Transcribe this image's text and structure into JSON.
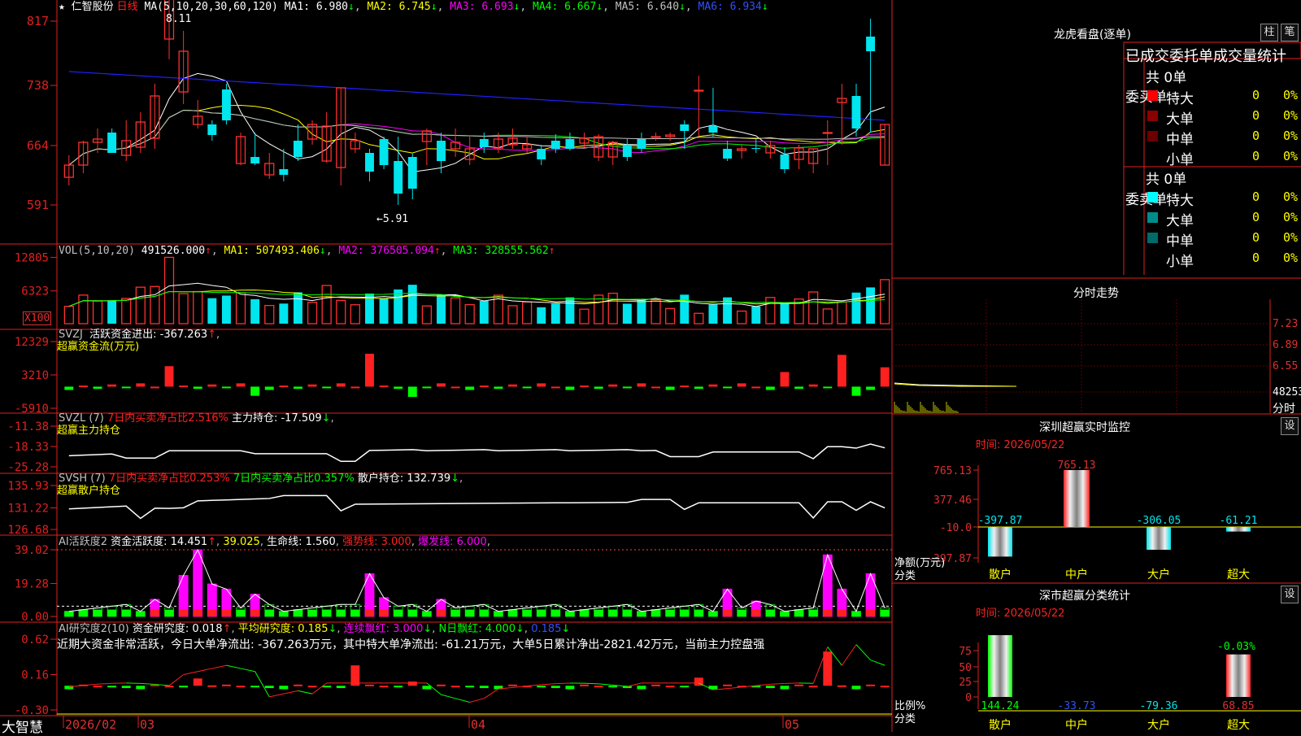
{
  "stock": {
    "name": "仁智股份",
    "period": "日线",
    "brand": "大智慧"
  },
  "colors": {
    "up": "#ff2020",
    "down": "#00e5ee",
    "ma1": "#ffffff",
    "ma2": "#ffff00",
    "ma3": "#ff00ff",
    "ma4": "#00ff00",
    "ma5": "#c0c0c0",
    "ma6": "#2020ff"
  },
  "kline": {
    "legend": {
      "ma": "MA(5,10,20,30,60,120)",
      "ma1": "MA1: 6.980",
      "ma2": "MA2: 6.745",
      "ma3": "MA3: 6.693",
      "ma4": "MA4: 6.667",
      "ma5": "MA5: 6.640",
      "ma6": "MA6: 6.934"
    },
    "yticks": [
      "817",
      "738",
      "664",
      "591"
    ],
    "high_label": "8.11",
    "low_label": "←5.91"
  },
  "vol": {
    "legend": {
      "name": "VOL(5,10,20)",
      "v": "491526.000",
      "ma1": "MA1: 507493.406",
      "ma2": "MA2: 376505.094",
      "ma3": "MA3: 328555.562"
    },
    "yticks": [
      "12805",
      "6323"
    ],
    "unit": "X100"
  },
  "svzj": {
    "legend": {
      "name": "SVZJ",
      "t1": "活跃资金进出: -367.263",
      "t2": "超赢资金流(万元)"
    },
    "yticks": [
      "12329",
      "3210",
      "-5910"
    ]
  },
  "svzl": {
    "legend": {
      "name": "SVZL (7)",
      "t1": "7日内买卖净占比2.516%",
      "t2": "主力持仓: -17.509",
      "t3": "超赢主力持仓"
    },
    "yticks": [
      "-11.38",
      "-18.33",
      "-25.28"
    ]
  },
  "svsh": {
    "legend": {
      "name": "SVSH (7)",
      "t1": "7日内买卖净占比0.253%",
      "t2": "7日内买卖净占比0.357%",
      "t3": "散户持仓: 132.739",
      "t4": "超赢散户持仓"
    },
    "yticks": [
      "135.93",
      "131.22",
      "126.68"
    ]
  },
  "ai1": {
    "legend": {
      "name": "AI活跃度2",
      "t1": "资金活跃度: 14.451",
      "t2": "39.025",
      "t3": "生命线: 1.560",
      "t4": "强势线: 3.000",
      "t5": "爆发线: 6.000"
    },
    "yticks": [
      "39.02",
      "19.28",
      "0.00"
    ]
  },
  "ai2": {
    "legend": {
      "name": "AI研究度2(10)",
      "t1": "资金研究度: 0.018",
      "t2": "平均研究度: 0.185",
      "t3": "连续飘红: 3.000",
      "t4": "N日飘红: 4.000",
      "t5": "0.185"
    },
    "comment": "近期大资金非常活跃，今日大单净流出: -367.263万元，其中特大单净流出: -61.21万元，大单5日累计净出-2821.42万元，当前主力控盘强",
    "yticks": [
      "0.62",
      "0.16",
      "-0.30"
    ]
  },
  "xaxis": {
    "labels": [
      "2026/02",
      "03",
      "04",
      "05"
    ]
  },
  "right": {
    "lhb_title": "龙虎看盘(逐单)",
    "btn1": "柱",
    "btn2": "笔",
    "table_title": "已成交委托单成交量统计",
    "buy": {
      "side": "委买单",
      "total": "共 0单",
      "rows": [
        {
          "name": "特大",
          "v": "0",
          "p": "0%",
          "c": "#ff0000"
        },
        {
          "name": "大单",
          "v": "0",
          "p": "0%",
          "c": "#8b0000"
        },
        {
          "name": "中单",
          "v": "0",
          "p": "0%",
          "c": "#6a0000"
        },
        {
          "name": "小单",
          "v": "0",
          "p": "0%",
          "c": "#000000"
        }
      ]
    },
    "sell": {
      "side": "委卖单",
      "total": "共 0单",
      "rows": [
        {
          "name": "特大",
          "v": "0",
          "p": "0%",
          "c": "#00ffff"
        },
        {
          "name": "大单",
          "v": "0",
          "p": "0%",
          "c": "#008b8b"
        },
        {
          "name": "中单",
          "v": "0",
          "p": "0%",
          "c": "#006a6a"
        },
        {
          "name": "小单",
          "v": "0",
          "p": "0%",
          "c": "#000000"
        }
      ]
    },
    "fs": {
      "title": "分时走势",
      "yticks": [
        "7.23",
        "6.89",
        "6.55",
        "48253"
      ],
      "unit": "分时"
    },
    "sz": {
      "title": "深圳超赢实时监控",
      "btn": "设",
      "time": "时间: 2026/05/22",
      "yticks": [
        "765.13",
        "377.46",
        "-10.0",
        "-397.87"
      ],
      "ylabel1": "净额(万元)",
      "ylabel2": "分类",
      "cats": [
        "散户",
        "中户",
        "大户",
        "超大"
      ],
      "values": [
        -397.87,
        765.13,
        -306.05,
        -61.21
      ],
      "vlabels": [
        "-397.87",
        "765.13",
        "-306.05",
        "-61.21"
      ]
    },
    "sc": {
      "title": "深市超赢分类统计",
      "btn": "设",
      "time": "时间: 2026/05/22",
      "yticks": [
        "75",
        "50",
        "25",
        "0"
      ],
      "ylabel1": "比例%",
      "ylabel2": "分类",
      "cats": [
        "散户",
        "中户",
        "大户",
        "超大"
      ],
      "values": [
        144.24,
        -33.73,
        -79.36,
        68.85
      ],
      "vlabels": [
        "144.24",
        "-33.73",
        "-79.36",
        "68.85"
      ],
      "extra": "-0.03%"
    }
  },
  "chart_data": {
    "type": "candlestick",
    "title": "仁智股份 日线",
    "x": [
      "2026/02",
      "",
      "",
      "",
      "",
      "",
      "",
      "",
      "",
      "",
      "",
      "",
      "",
      "",
      "",
      "",
      "",
      "",
      "",
      "",
      "",
      "",
      "",
      "",
      "",
      "",
      "",
      "",
      "",
      "",
      "",
      "",
      "",
      "",
      "",
      "",
      "",
      "",
      "",
      "",
      "",
      "",
      "",
      "",
      "",
      "",
      "",
      "",
      "",
      "",
      "",
      "",
      "",
      "",
      "",
      "",
      ""
    ],
    "open": [
      6.25,
      6.4,
      6.68,
      6.8,
      6.52,
      6.62,
      6.73,
      7.95,
      7.3,
      6.9,
      6.9,
      7.33,
      6.42,
      6.5,
      6.28,
      6.35,
      6.7,
      6.72,
      6.45,
      6.37,
      6.6,
      6.55,
      6.72,
      6.45,
      6.5,
      6.69,
      6.7,
      6.6,
      6.47,
      6.72,
      6.61,
      6.65,
      6.6,
      6.6,
      6.7,
      6.72,
      6.67,
      6.5,
      6.5,
      6.65,
      6.72,
      6.74,
      6.75,
      6.9,
      7.32,
      6.88,
      6.6,
      6.58,
      6.61,
      6.55,
      6.53,
      6.47,
      6.42,
      6.79,
      7.17,
      7.25,
      7.98,
      6.4
    ],
    "close": [
      6.4,
      6.68,
      6.72,
      6.55,
      6.7,
      6.93,
      7.25,
      8.65,
      7.8,
      7.0,
      6.77,
      6.95,
      6.75,
      6.42,
      6.42,
      6.28,
      6.5,
      6.9,
      6.88,
      7.35,
      6.7,
      6.32,
      6.4,
      6.05,
      6.11,
      6.82,
      6.45,
      6.68,
      6.6,
      6.62,
      6.72,
      6.73,
      6.65,
      6.47,
      6.6,
      6.6,
      6.73,
      6.75,
      6.68,
      6.5,
      6.6,
      6.75,
      6.77,
      6.82,
      7.32,
      6.8,
      6.48,
      6.6,
      6.6,
      6.64,
      6.35,
      6.61,
      6.6,
      6.8,
      7.22,
      6.85,
      7.8,
      6.9
    ],
    "high": [
      6.52,
      6.7,
      6.85,
      6.85,
      6.95,
      7.05,
      7.4,
      8.4,
      8.05,
      7.2,
      6.95,
      7.4,
      6.8,
      6.8,
      6.55,
      6.6,
      6.9,
      6.95,
      7.05,
      7.35,
      6.8,
      6.6,
      6.75,
      6.75,
      6.55,
      6.85,
      6.8,
      6.85,
      6.75,
      6.8,
      6.8,
      6.85,
      6.75,
      6.65,
      6.78,
      6.8,
      6.8,
      6.78,
      6.7,
      6.72,
      6.8,
      6.8,
      6.8,
      6.95,
      7.5,
      7.35,
      6.7,
      6.65,
      6.72,
      6.7,
      6.62,
      6.65,
      6.55,
      6.95,
      7.4,
      7.4,
      8.2,
      6.7
    ],
    "low": [
      6.15,
      6.3,
      6.55,
      6.6,
      6.45,
      6.55,
      6.6,
      7.7,
      7.15,
      6.85,
      6.7,
      6.9,
      6.4,
      6.4,
      6.23,
      6.2,
      6.45,
      6.65,
      6.43,
      6.15,
      6.55,
      6.2,
      6.35,
      5.91,
      5.98,
      6.4,
      6.3,
      6.5,
      6.4,
      6.55,
      6.55,
      6.6,
      6.55,
      6.4,
      6.55,
      6.58,
      6.62,
      6.45,
      6.4,
      6.45,
      6.55,
      6.7,
      6.7,
      6.6,
      6.75,
      6.75,
      6.45,
      6.48,
      6.55,
      6.48,
      6.3,
      6.35,
      6.3,
      6.4,
      6.65,
      6.75,
      6.8,
      6.4
    ],
    "ylim": [
      5.85,
      8.25
    ]
  }
}
